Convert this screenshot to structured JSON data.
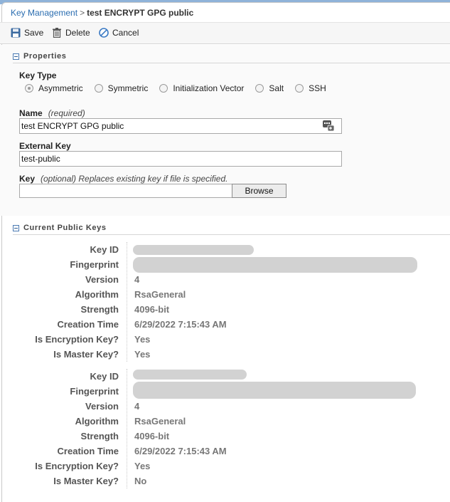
{
  "breadcrumb": {
    "parent": "Key Management",
    "separator": ">",
    "current": "test ENCRYPT GPG public"
  },
  "toolbar": {
    "save_label": "Save",
    "delete_label": "Delete",
    "cancel_label": "Cancel"
  },
  "properties": {
    "section_title": "Properties",
    "key_type_label": "Key Type",
    "key_types": [
      "Asymmetric",
      "Symmetric",
      "Initialization Vector",
      "Salt",
      "SSH"
    ],
    "selected_key_type": "Asymmetric",
    "name_label": "Name",
    "name_hint": "(required)",
    "name_value": "test ENCRYPT GPG public",
    "external_key_label": "External Key",
    "external_key_value": "test-public",
    "key_label": "Key",
    "key_hint": "(optional) Replaces existing key if file is specified.",
    "browse_label": "Browse"
  },
  "current_public_keys": {
    "section_title": "Current Public Keys",
    "labels": {
      "key_id": "Key ID",
      "fingerprint": "Fingerprint",
      "version": "Version",
      "algorithm": "Algorithm",
      "strength": "Strength",
      "creation_time": "Creation Time",
      "is_encryption_key": "Is Encryption Key?",
      "is_master_key": "Is Master Key?"
    },
    "keys": [
      {
        "version": "4",
        "algorithm": "RsaGeneral",
        "strength": "4096-bit",
        "creation_time": "6/29/2022 7:15:43 AM",
        "is_encryption_key": "Yes",
        "is_master_key": "Yes"
      },
      {
        "version": "4",
        "algorithm": "RsaGeneral",
        "strength": "4096-bit",
        "creation_time": "6/29/2022 7:15:43 AM",
        "is_encryption_key": "Yes",
        "is_master_key": "No"
      }
    ]
  },
  "colors": {
    "link": "#2a6db0",
    "toolbar_bg": "#f6f6f6",
    "label_text": "#555555",
    "value_text": "#777777"
  }
}
